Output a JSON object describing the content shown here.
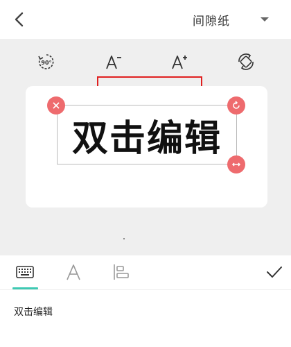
{
  "topbar": {
    "back_icon": "chevron-left-icon",
    "paper_type": "间隙纸",
    "dropdown_icon": "caret-down-icon"
  },
  "toolbar": {
    "tools": [
      {
        "name": "rotate-90",
        "label": "90°",
        "icon": "rotate-90-icon"
      },
      {
        "name": "font-size-decrease",
        "label": "A⁻",
        "icon": "font-decrease-icon"
      },
      {
        "name": "font-size-increase",
        "label": "A⁺",
        "icon": "font-increase-icon"
      },
      {
        "name": "flip",
        "icon": "flip-icon"
      }
    ],
    "highlight_color": "#e02020"
  },
  "editor": {
    "text": "双击编辑",
    "handle_color": "#ee6b6e",
    "handles": [
      "delete-icon",
      "rotate-icon",
      "resize-icon"
    ]
  },
  "tabs": [
    {
      "name": "keyboard",
      "icon": "keyboard-icon",
      "active": true
    },
    {
      "name": "font",
      "icon": "font-icon",
      "active": false
    },
    {
      "name": "align",
      "icon": "align-left-icon",
      "active": false
    }
  ],
  "confirm_icon": "check-icon",
  "accent_color": "#3ec9b3",
  "input": {
    "value": "双击编辑"
  }
}
